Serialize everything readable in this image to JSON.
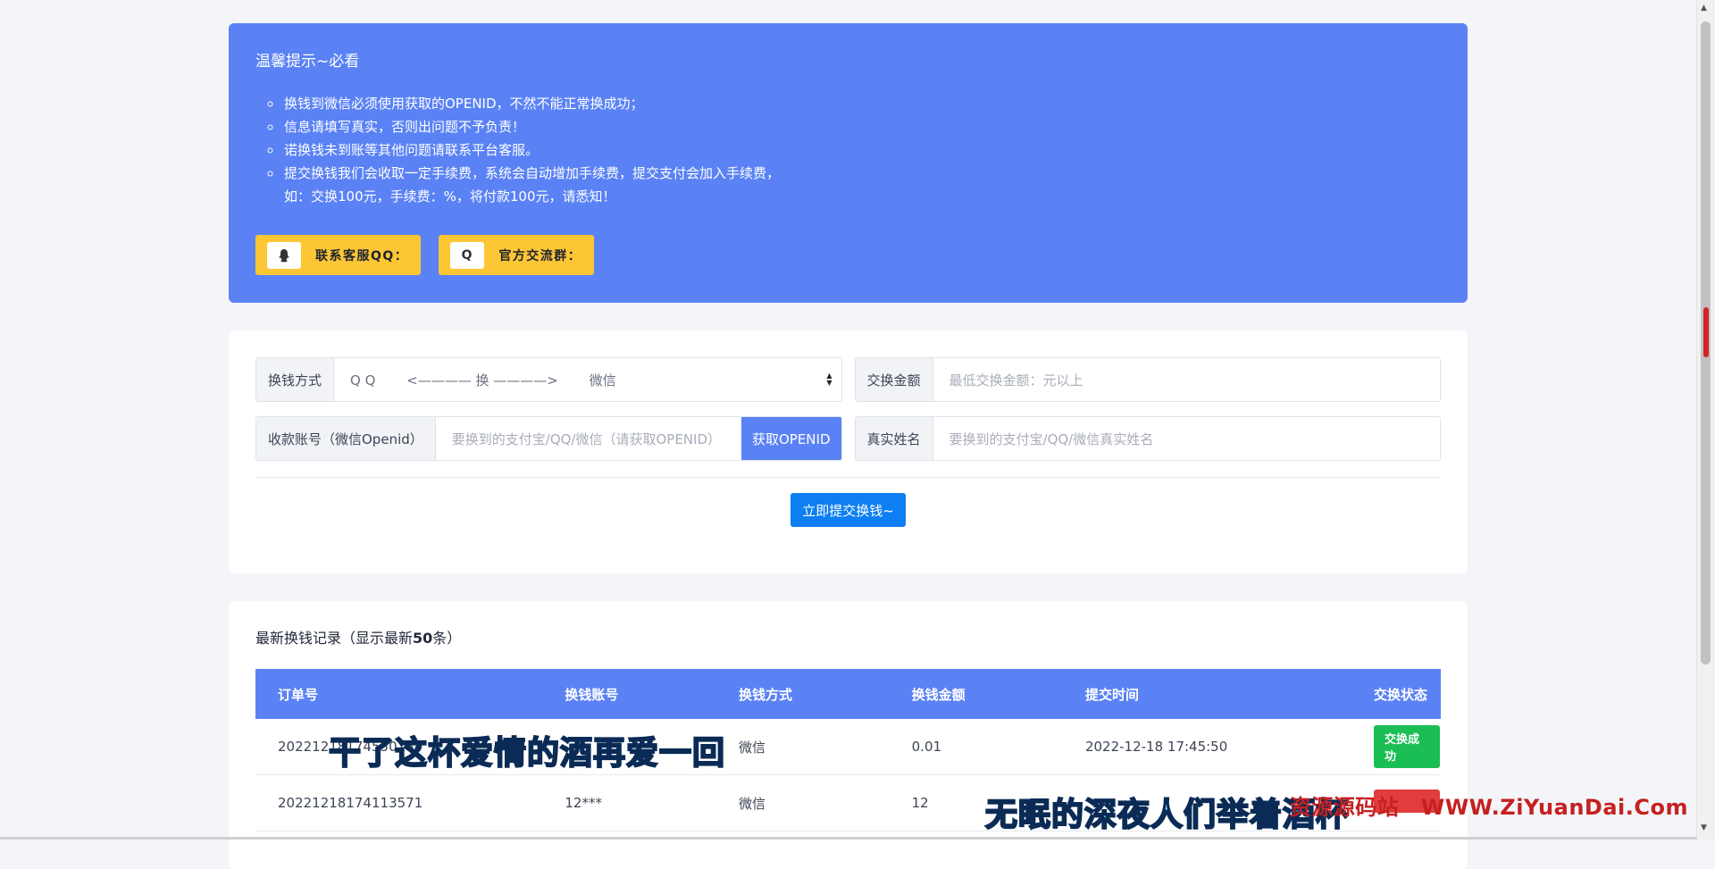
{
  "notice": {
    "title": "温馨提示~必看",
    "items": [
      "换钱到微信必须使用获取的OPENID，不然不能正常换成功；",
      "信息请填写真实，否则出问题不予负责！",
      "诺换钱未到账等其他问题请联系平台客服。",
      "提交换钱我们会收取一定手续费，系统会自动增加手续费，提交支付会加入手续费，",
      "如：交换100元，手续费：%，将付款100元，请悉知！"
    ],
    "buttons": [
      {
        "icon": "qq-penguin-icon",
        "label": "联系客服QQ："
      },
      {
        "icon": "qq-group-icon",
        "icon_text": "Q",
        "label": "官方交流群："
      }
    ]
  },
  "form": {
    "method_label": "换钱方式",
    "method_value": "Q Q　　 <———— 换 ————>　　 微信",
    "amount_label": "交换金额",
    "amount_placeholder": "最低交换金额：元以上",
    "account_label": "收款账号（微信Openid）",
    "account_placeholder": "要换到的支付宝/QQ/微信（请获取OPENID）",
    "get_openid_label": "获取OPENID",
    "name_label": "真实姓名",
    "name_placeholder": "要换到的支付宝/QQ/微信真实姓名",
    "submit_label": "立即提交换钱~"
  },
  "records": {
    "title_prefix": "最新换钱记录（显示最新",
    "title_count": "50",
    "title_suffix": "条）",
    "columns": [
      "订单号",
      "换钱账号",
      "换钱方式",
      "换钱金额",
      "提交时间",
      "交换状态"
    ],
    "rows": [
      {
        "order": "20221218174550184",
        "account": "",
        "method": "微信",
        "amount": "0.01",
        "time": "2022-12-18 17:45:50",
        "status": "交换成功",
        "status_color": "#1bbd55"
      },
      {
        "order": "20221218174113571",
        "account": "12***",
        "method": "微信",
        "amount": "12",
        "time": "",
        "status": "",
        "status_color": "#e23d3d"
      }
    ]
  },
  "overlay": {
    "lyric_1": "干了这杯爱情的酒再爱一回",
    "lyric_2": "无眠的深夜人们举着酒杯",
    "watermark": "资源源码站　WWW.ZiYuanDai.Com"
  }
}
